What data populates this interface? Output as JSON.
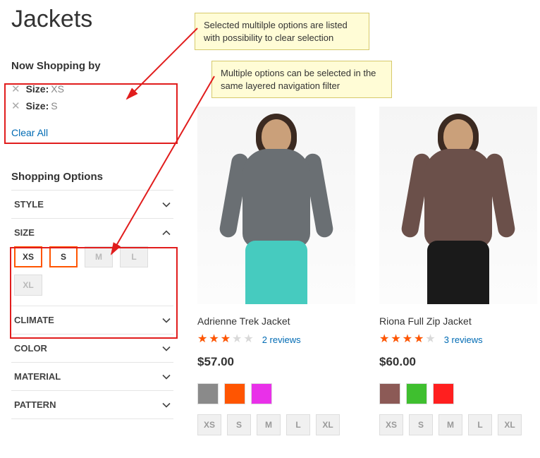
{
  "page_title": "Jackets",
  "annotations": {
    "callout_selected": "Selected multilple options are listed with possibility to clear selection",
    "callout_multi": "Multiple options can be selected in the same layered navigation filter"
  },
  "sidebar": {
    "now_shopping_by_label": "Now Shopping by",
    "active_filters": [
      {
        "label": "Size:",
        "value": "XS"
      },
      {
        "label": "Size:",
        "value": "S"
      }
    ],
    "clear_all_label": "Clear All",
    "shopping_options_label": "Shopping Options",
    "filters": [
      {
        "name": "STYLE",
        "expanded": false
      },
      {
        "name": "SIZE",
        "expanded": true,
        "options": [
          {
            "label": "XS",
            "selected": true
          },
          {
            "label": "S",
            "selected": true
          },
          {
            "label": "M",
            "selected": false
          },
          {
            "label": "L",
            "selected": false
          },
          {
            "label": "XL",
            "selected": false
          }
        ]
      },
      {
        "name": "CLIMATE",
        "expanded": false
      },
      {
        "name": "COLOR",
        "expanded": false
      },
      {
        "name": "MATERIAL",
        "expanded": false
      },
      {
        "name": "PATTERN",
        "expanded": false
      }
    ]
  },
  "products": [
    {
      "name": "Adrienne Trek Jacket",
      "rating_pct": 60,
      "reviews_text": "2 reviews",
      "price": "$57.00",
      "colors": [
        "#8a8a8a",
        "#ff5501",
        "#e930e9"
      ],
      "sizes": [
        "XS",
        "S",
        "M",
        "L",
        "XL"
      ],
      "fig": {
        "skin": "#caa07a",
        "jacket": "#6a6f73",
        "legs": "#46cbbf"
      }
    },
    {
      "name": "Riona Full Zip Jacket",
      "rating_pct": 80,
      "reviews_text": "3 reviews",
      "price": "$60.00",
      "colors": [
        "#8c5a56",
        "#3fbf2f",
        "#ff1f1f"
      ],
      "sizes": [
        "XS",
        "S",
        "M",
        "L",
        "XL"
      ],
      "fig": {
        "skin": "#caa07a",
        "jacket": "#6b504a",
        "legs": "#1a1a1a"
      }
    }
  ]
}
